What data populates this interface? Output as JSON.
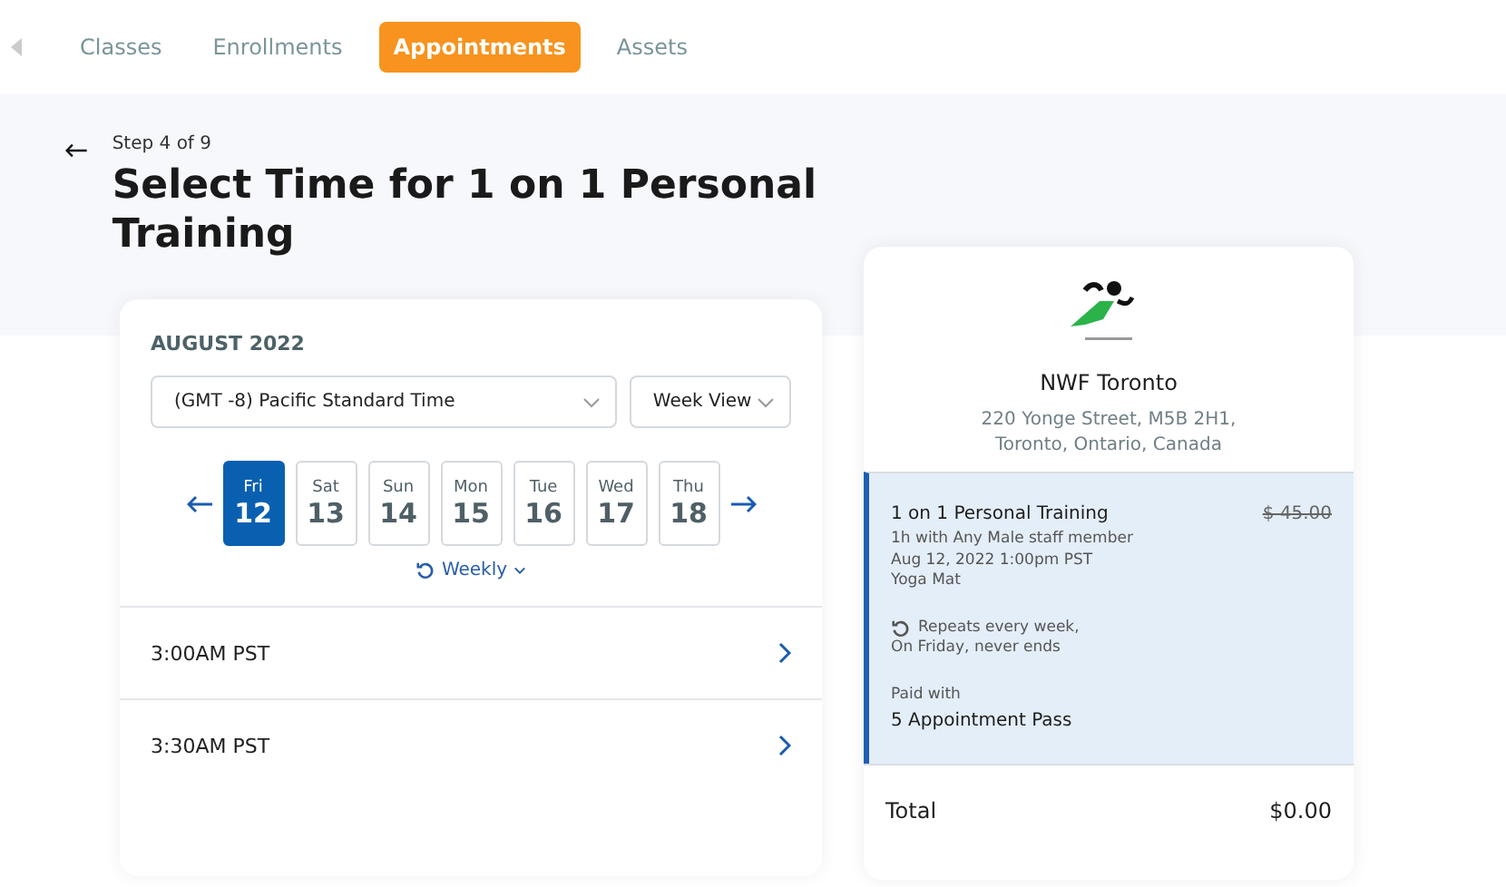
{
  "nav": {
    "tabs": [
      {
        "label": "Classes",
        "selected": false
      },
      {
        "label": "Enrollments",
        "selected": false
      },
      {
        "label": "Appointments",
        "selected": true
      },
      {
        "label": "Assets",
        "selected": false
      }
    ]
  },
  "header": {
    "step": "Step 4 of 9",
    "title": "Select Time for 1 on 1 Personal Training"
  },
  "calendar": {
    "month": "AUGUST 2022",
    "timezone": "(GMT -8) Pacific Standard Time",
    "view": "Week View",
    "days": [
      {
        "weekday": "Fri",
        "date": "12",
        "selected": true
      },
      {
        "weekday": "Sat",
        "date": "13",
        "selected": false
      },
      {
        "weekday": "Sun",
        "date": "14",
        "selected": false
      },
      {
        "weekday": "Mon",
        "date": "15",
        "selected": false
      },
      {
        "weekday": "Tue",
        "date": "16",
        "selected": false
      },
      {
        "weekday": "Wed",
        "date": "17",
        "selected": false
      },
      {
        "weekday": "Thu",
        "date": "18",
        "selected": false
      }
    ],
    "repeat": "Weekly",
    "slots": [
      "3:00AM PST",
      "3:30AM PST"
    ]
  },
  "summary": {
    "name": "NWF Toronto",
    "address": [
      "220 Yonge Street, M5B 2H1,",
      "Toronto, Ontario, Canada"
    ],
    "item": {
      "title": "1 on 1 Personal Training",
      "price": "$ 45.00",
      "details": [
        "1h with Any Male staff member",
        "Aug 12, 2022 1:00pm PST",
        "Yoga Mat"
      ],
      "repeat": [
        "Repeats every week,",
        "On Friday, never ends"
      ],
      "paid_label": "Paid with",
      "paid_value": "5 Appointment Pass"
    },
    "total_label": "Total",
    "total_value": "$0.00"
  }
}
